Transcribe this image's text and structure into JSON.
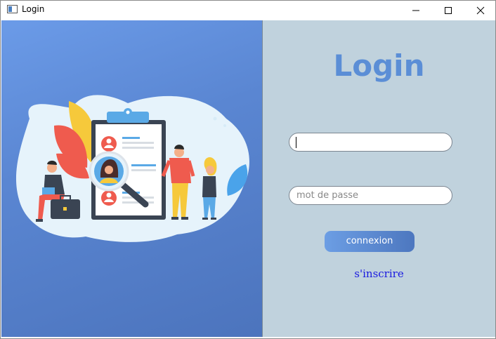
{
  "window": {
    "title": "Login"
  },
  "illustration": {
    "icon": "recruitment-illustration"
  },
  "form": {
    "heading": "Login",
    "username_value": "",
    "password_placeholder": "mot de passe",
    "submit_label": "connexion",
    "signup_label": "s'inscrire"
  },
  "colors": {
    "accent": "#5b8ed6",
    "panel_bg": "#c0d2dd",
    "link": "#1a1ae0"
  }
}
